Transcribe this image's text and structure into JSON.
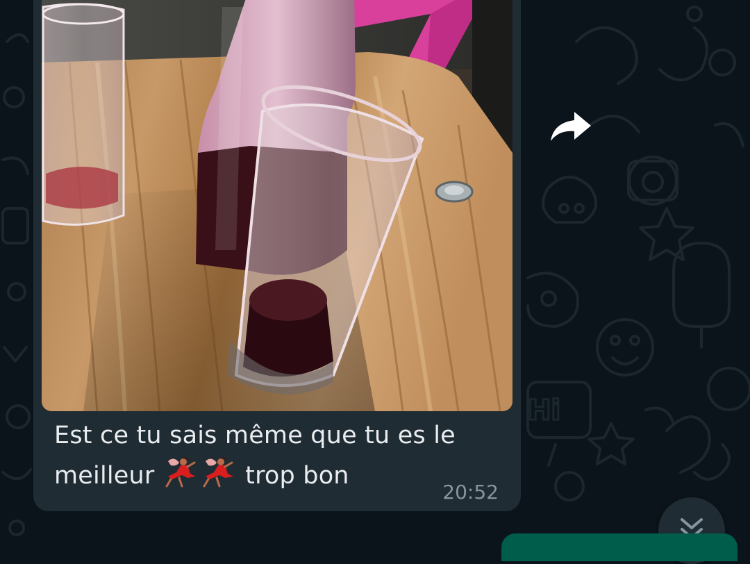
{
  "chat": {
    "incoming_message": {
      "caption_line1": "Est ce tu sais même que tu es le",
      "caption_word": "meilleur",
      "caption_tail": "trop bon",
      "emoji": [
        "dancer-emoji",
        "dancer-emoji"
      ],
      "time": "20:52",
      "media": "photo"
    },
    "wallpaper_doodle_text": "Hi"
  },
  "icons": {
    "forward": "forward-arrow-icon",
    "scroll_down": "double-chevron-down-icon"
  },
  "colors": {
    "background": "#0b141a",
    "incoming_bubble": "#202c33",
    "outgoing_bubble": "#005c4b",
    "text": "#e9edef",
    "meta_text": "#8696a0"
  }
}
